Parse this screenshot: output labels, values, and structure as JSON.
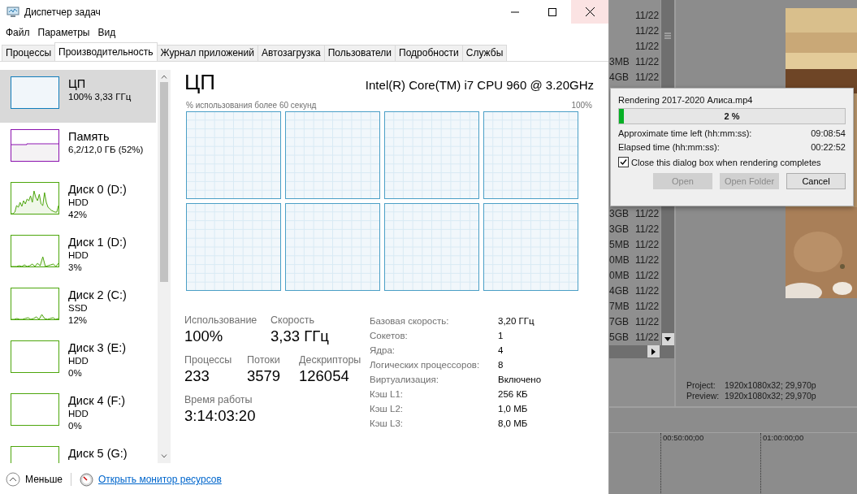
{
  "window": {
    "title": "Диспетчер задач"
  },
  "menu": [
    "Файл",
    "Параметры",
    "Вид"
  ],
  "tabs": [
    {
      "label": "Процессы",
      "selected": false
    },
    {
      "label": "Производительность",
      "selected": true
    },
    {
      "label": "Журнал приложений",
      "selected": false
    },
    {
      "label": "Автозагрузка",
      "selected": false
    },
    {
      "label": "Пользователи",
      "selected": false
    },
    {
      "label": "Подробности",
      "selected": false
    },
    {
      "label": "Службы",
      "selected": false
    }
  ],
  "sidebar": {
    "items": [
      {
        "kind": "cpu",
        "title": "ЦП",
        "lines": [
          "100%  3,33 ГГц"
        ],
        "selected": true
      },
      {
        "kind": "memory",
        "title": "Память",
        "lines": [
          "6,2/12,0 ГБ (52%)"
        ],
        "selected": false
      },
      {
        "kind": "disk",
        "title": "Диск 0 (D:)",
        "lines": [
          "HDD",
          "42%"
        ],
        "selected": false
      },
      {
        "kind": "disk",
        "title": "Диск 1 (D:)",
        "lines": [
          "HDD",
          "3%"
        ],
        "selected": false
      },
      {
        "kind": "disk",
        "title": "Диск 2 (C:)",
        "lines": [
          "SSD",
          "12%"
        ],
        "selected": false
      },
      {
        "kind": "disk",
        "title": "Диск 3 (E:)",
        "lines": [
          "HDD",
          "0%"
        ],
        "selected": false
      },
      {
        "kind": "disk",
        "title": "Диск 4 (F:)",
        "lines": [
          "HDD",
          "0%"
        ],
        "selected": false
      },
      {
        "kind": "disk",
        "title": "Диск 5 (G:)",
        "selected": false
      }
    ]
  },
  "cpu": {
    "title": "ЦП",
    "model": "Intel(R) Core(TM) i7 CPU 960 @ 3.20GHz",
    "graph_label": "% использования более 60 секунд",
    "graph_max": "100%",
    "stats_row_1": [
      {
        "label": "Использование",
        "value": "100%"
      },
      {
        "label": "Скорость",
        "value": "3,33 ГГц"
      }
    ],
    "stats_row_2": [
      {
        "label": "Процессы",
        "value": "233"
      },
      {
        "label": "Потоки",
        "value": "3579"
      },
      {
        "label": "Дескрипторы",
        "value": "126054"
      }
    ],
    "uptime": {
      "label": "Время работы",
      "value": "3:14:03:20"
    },
    "details": [
      {
        "label": "Базовая скорость:",
        "value": "3,20 ГГц"
      },
      {
        "label": "Сокетов:",
        "value": "1"
      },
      {
        "label": "Ядра:",
        "value": "4"
      },
      {
        "label": "Логических процессоров:",
        "value": "8"
      },
      {
        "label": "Виртуализация:",
        "value": "Включено"
      },
      {
        "label": "Кэш L1:",
        "value": "256 КБ"
      },
      {
        "label": "Кэш L2:",
        "value": "1,0 МБ"
      },
      {
        "label": "Кэш L3:",
        "value": "8,0 МБ"
      }
    ]
  },
  "footer": {
    "less": "Меньше",
    "link": "Открыть монитор ресурсов"
  },
  "background_app": {
    "file_rows_top": [
      {
        "date": "11/22"
      },
      {
        "date": "11/22"
      },
      {
        "date": "11/22"
      },
      {
        "size": "3MB",
        "date": "11/22"
      },
      {
        "size": "4GB",
        "date": "11/22"
      }
    ],
    "file_rows_bottom": [
      {
        "size": "3GB",
        "date": "11/22"
      },
      {
        "size": "3GB",
        "date": "11/22"
      },
      {
        "size": "5MB",
        "date": "11/22"
      },
      {
        "size": "0MB",
        "date": "11/22"
      },
      {
        "size": "0MB",
        "date": "11/22"
      },
      {
        "size": "4GB",
        "date": "11/22"
      },
      {
        "size": "7MB",
        "date": "11/22"
      },
      {
        "size": "7GB",
        "date": "11/22"
      },
      {
        "size": "5GB",
        "date": "11/22"
      }
    ],
    "preview_info": [
      {
        "label": "Project:",
        "value": "1920x1080x32; 29,970p"
      },
      {
        "label": "Preview:",
        "value": "1920x1080x32; 29,970p"
      }
    ],
    "timeline_marks": [
      "00:50:00;00",
      "01:00:00;00"
    ]
  },
  "render_dialog": {
    "title": "Rendering 2017-2020 Алиса.mp4",
    "progress": {
      "level": 0.02,
      "label": "2 %"
    },
    "rows": [
      {
        "label": "Approximate time left (hh:mm:ss):",
        "value": "09:08:54"
      },
      {
        "label": "Elapsed time (hh:mm:ss):",
        "value": "00:22:52"
      }
    ],
    "close_when_done": {
      "label": "Close this dialog box when rendering completes",
      "checked": true
    },
    "buttons": [
      {
        "label": "Open",
        "disabled": true
      },
      {
        "label": "Open Folder",
        "disabled": true
      },
      {
        "label": "Cancel",
        "disabled": false
      }
    ]
  }
}
